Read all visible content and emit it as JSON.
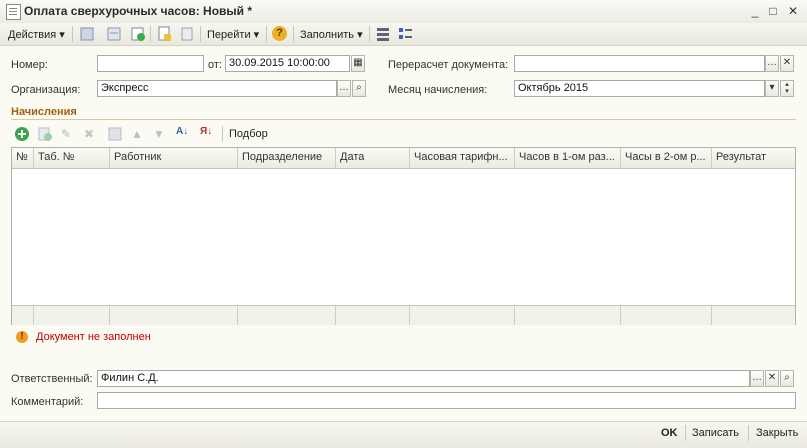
{
  "window": {
    "title": "Оплата сверхурочных часов: Новый *"
  },
  "toolbar": {
    "actions_label": "Действия",
    "goto_label": "Перейти",
    "fill_label": "Заполнить"
  },
  "form": {
    "number_label": "Номер:",
    "number_value": "",
    "date_label": "от:",
    "date_value": "30.09.2015 10:00:00",
    "org_label": "Организация:",
    "org_value": "Экспресс",
    "recalc_label": "Перерасчет документа:",
    "recalc_value": "",
    "month_label": "Месяц начисления:",
    "month_value": "Октябрь 2015"
  },
  "accruals": {
    "title": "Начисления",
    "selection_label": "Подбор",
    "columns": [
      "№",
      "Таб. №",
      "Работник",
      "Подразделение",
      "Дата",
      "Часовая тарифн...",
      "Часов в 1-ом раз...",
      "Часы в 2-ом р...",
      "Результат"
    ]
  },
  "warning": {
    "text": "Документ не заполнен"
  },
  "footer_fields": {
    "responsible_label": "Ответственный:",
    "responsible_value": "Филин С.Д.",
    "comment_label": "Комментарий:",
    "comment_value": ""
  },
  "buttons": {
    "ok": "OK",
    "save": "Записать",
    "close": "Закрыть"
  },
  "icons": [
    "app-icon",
    "minimize-icon",
    "maximize-icon",
    "close-icon",
    "help-icon",
    "calendar-icon",
    "search-icon",
    "clear-icon",
    "add-icon",
    "edit-icon",
    "delete-icon",
    "move-up-icon",
    "move-down-icon",
    "sort-asc-icon",
    "sort-desc-icon",
    "warning-icon"
  ],
  "colors": {
    "section_title": "#a85c0e",
    "warning_text": "#c00000",
    "background": "#fbfbf3"
  }
}
